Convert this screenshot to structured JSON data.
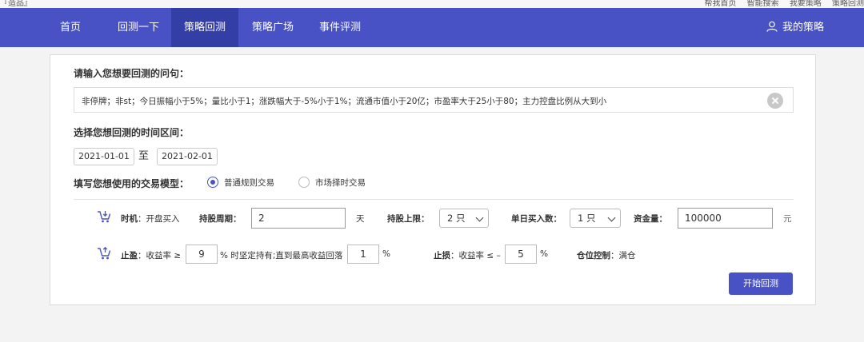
{
  "top_strip": {
    "left": "『造品』",
    "right": [
      "帮我首页",
      "智能搜索",
      "我要策略",
      "策略回测"
    ]
  },
  "nav": {
    "items": [
      "首页",
      "回测一下",
      "策略回测",
      "策略广场",
      "事件评测"
    ],
    "active_index": 2,
    "my_strategy": "我的策略",
    "bg_color": "#4852c4",
    "active_color": "#343fa6"
  },
  "query": {
    "label": "请输入您想要回测的问句：",
    "value": "非停牌；非st；今日振幅小于5%；量比小于1；涨跌幅大于-5%小于1%；流通市值小于20亿；市盈率大于25小于80；主力控盘比例从大到小"
  },
  "period": {
    "label": "选择您想回测的时间区间：",
    "start": "2021-01-01",
    "sep": "至",
    "end": "2021-02-01"
  },
  "model": {
    "label": "填写您想使用的交易模型：",
    "options": [
      "普通规则交易",
      "市场择时交易"
    ],
    "selected_index": 0
  },
  "buy_row": {
    "timing_label": "时机",
    "timing_value": "：开盘买入",
    "hold_label": "持股周期：",
    "hold_value": "2",
    "hold_unit": "天",
    "max_label": "持股上限：",
    "max_value": "2 只",
    "daily_label": "单日买入数：",
    "daily_value": "1 只",
    "fund_label": "资金量：",
    "fund_value": "100000",
    "fund_unit": "元"
  },
  "sell_row": {
    "tp_label": "止盈",
    "tp_text1": "：收益率 ≥",
    "tp_value": "9",
    "tp_text2": "% 时坚定持有;直到最高收益回落",
    "tp_pullback": "1",
    "tp_pct": "%",
    "sl_label": "止损",
    "sl_text": "：收益率 ≤ –",
    "sl_value": "5",
    "sl_pct": "%",
    "pos_label": "仓位控制",
    "pos_value": "：满仓"
  },
  "start_button": "开始回测",
  "icons": {
    "cart": "cart-icon",
    "user": "user-icon",
    "clear": "clear-icon"
  }
}
